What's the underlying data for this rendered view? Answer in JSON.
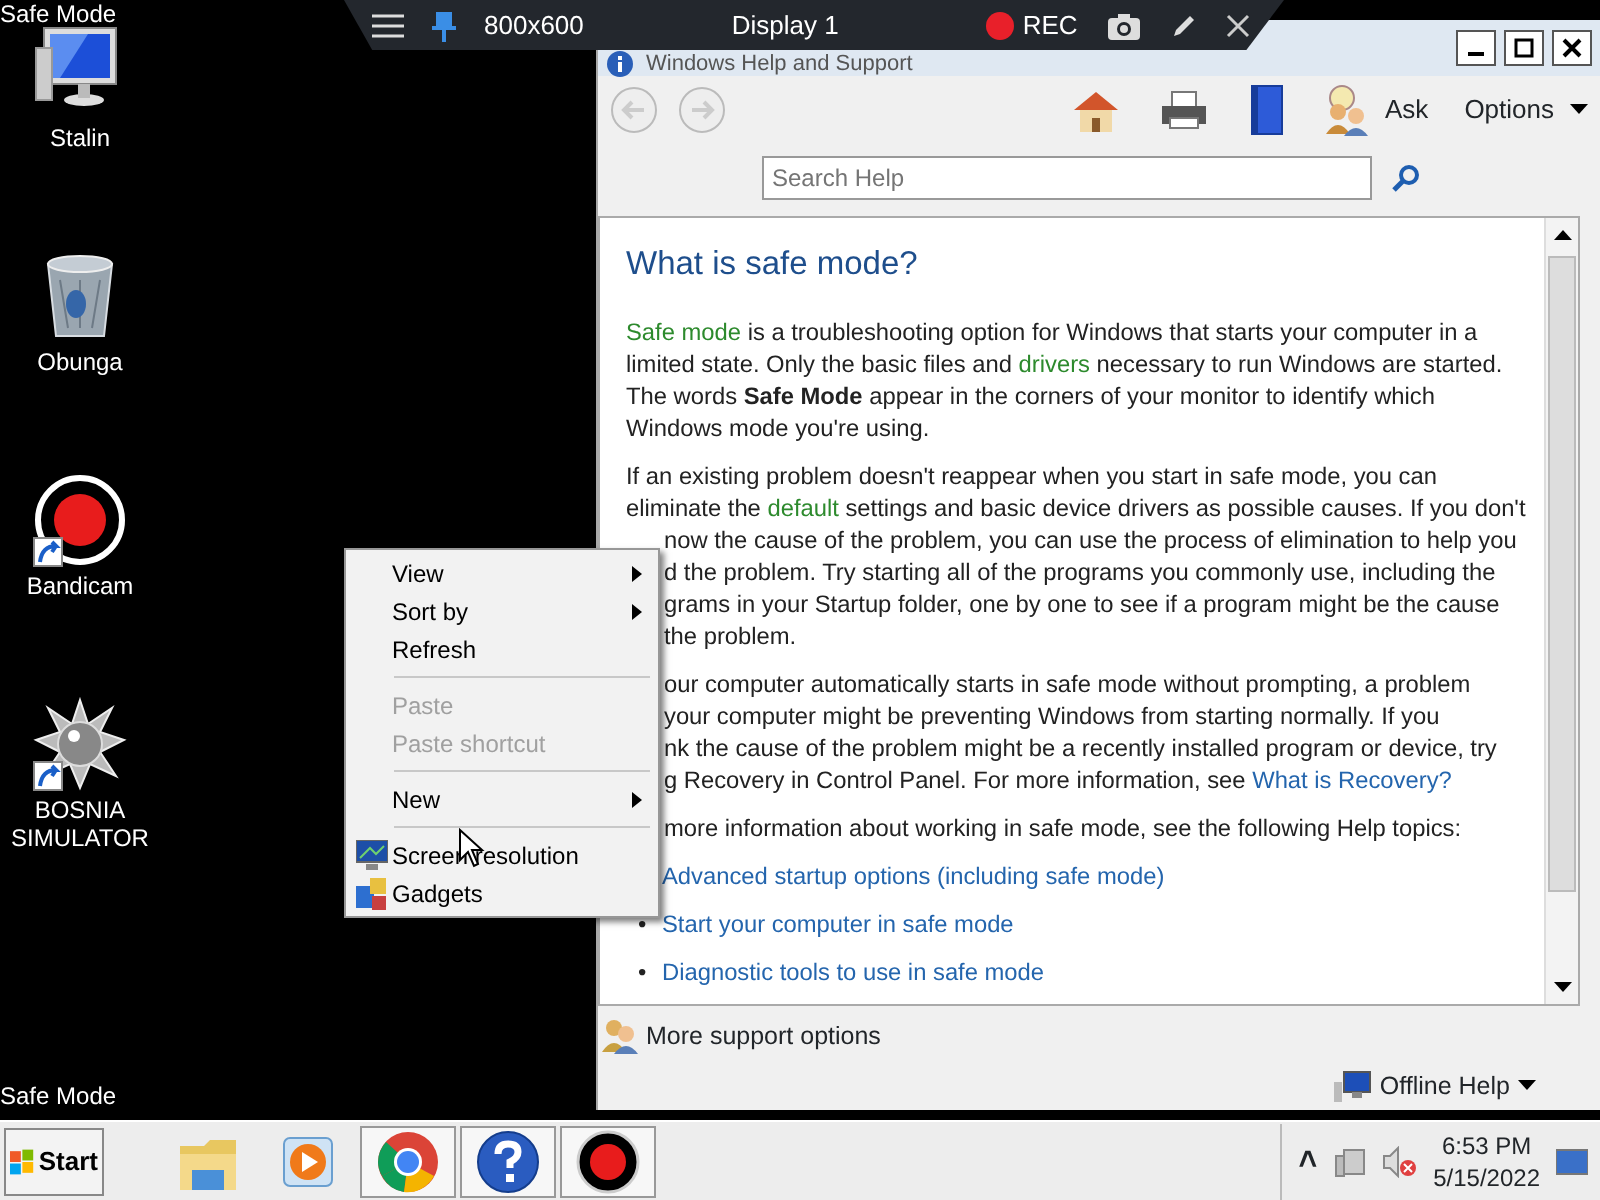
{
  "desktop": {
    "corner_labels": [
      "Safe Mode",
      "Safe Mode"
    ],
    "icons": [
      {
        "label": "Stalin",
        "kind": "computer",
        "shortcut": false
      },
      {
        "label": "Obunga",
        "kind": "recycle-bin",
        "shortcut": false
      },
      {
        "label": "Bandicam",
        "kind": "record",
        "shortcut": true
      },
      {
        "label": "BOSNIA SIMULATOR",
        "kind": "spiky-ball",
        "shortcut": true
      }
    ]
  },
  "recorder_toolbar": {
    "resolution": "800x600",
    "display": "Display 1",
    "rec": "REC"
  },
  "help_window": {
    "title": "Windows Help and Support",
    "ask": "Ask",
    "options": "Options",
    "search": {
      "placeholder": "Search Help"
    },
    "heading": "What is safe mode?",
    "paragraphs": [
      [
        {
          "kind": "full",
          "segments": [
            {
              "kind": "term",
              "text": "Safe mode"
            },
            {
              "kind": "text",
              "text": " is a troubleshooting option for Windows that starts your computer in a"
            }
          ]
        },
        {
          "kind": "full",
          "segments": [
            {
              "kind": "text",
              "text": "limited state. Only the basic files and "
            },
            {
              "kind": "term",
              "text": "drivers"
            },
            {
              "kind": "text",
              "text": " necessary to run Windows are started."
            }
          ]
        },
        {
          "kind": "full",
          "segments": [
            {
              "kind": "text",
              "text": "The words **Safe Mode** appear in the corners of your monitor to identify which"
            }
          ]
        },
        {
          "kind": "full",
          "segments": [
            {
              "kind": "text",
              "text": "Windows mode you're using."
            }
          ]
        }
      ],
      [
        {
          "kind": "full",
          "segments": [
            {
              "kind": "text",
              "text": "If an existing problem doesn't reappear when you start in safe mode, you can"
            }
          ]
        },
        {
          "kind": "full",
          "segments": [
            {
              "kind": "text",
              "text": "eliminate the "
            },
            {
              "kind": "term",
              "text": "default"
            },
            {
              "kind": "text",
              "text": " settings and basic device drivers as possible causes. If you don't"
            }
          ]
        },
        {
          "kind": "cut",
          "segments": [
            {
              "kind": "text",
              "text": "now the cause of the problem, you can use the process of elimination to help you"
            }
          ]
        },
        {
          "kind": "cut",
          "segments": [
            {
              "kind": "text",
              "text": "d the problem. Try starting all of the programs you commonly use, including the"
            }
          ]
        },
        {
          "kind": "cut",
          "segments": [
            {
              "kind": "text",
              "text": "grams in your Startup folder, one by one to see if a program might be the cause"
            }
          ]
        },
        {
          "kind": "cut",
          "segments": [
            {
              "kind": "text",
              "text": "the problem."
            }
          ]
        }
      ],
      [
        {
          "kind": "cut",
          "segments": [
            {
              "kind": "text",
              "text": "our computer automatically starts in safe mode without prompting, a problem"
            }
          ]
        },
        {
          "kind": "cut",
          "segments": [
            {
              "kind": "text",
              "text": "your computer might be preventing Windows from starting normally. If you"
            }
          ]
        },
        {
          "kind": "cut",
          "segments": [
            {
              "kind": "text",
              "text": "nk the cause of the problem might be a recently installed program or device, try"
            }
          ]
        },
        {
          "kind": "cut",
          "segments": [
            {
              "kind": "text",
              "text": "g Recovery in Control Panel. For more information, see "
            },
            {
              "kind": "link",
              "text": "What is Recovery?"
            }
          ]
        }
      ],
      [
        {
          "kind": "cut",
          "segments": [
            {
              "kind": "text",
              "text": "more information about working in safe mode, see the following Help topics:"
            }
          ]
        }
      ]
    ],
    "topics": [
      {
        "text": "Advanced startup options (including safe mode)"
      },
      {
        "bullet": "•",
        "text": "Start your computer in safe mode"
      },
      {
        "bullet": "•",
        "text": "Diagnostic tools to use in safe mode"
      }
    ],
    "more_support": "More support options",
    "offline_help": "Offline Help"
  },
  "context_menu": [
    {
      "kind": "item",
      "label": "View",
      "submenu": true,
      "disabled": false
    },
    {
      "kind": "item",
      "label": "Sort by",
      "submenu": true,
      "disabled": false
    },
    {
      "kind": "item",
      "label": "Refresh",
      "submenu": false,
      "disabled": false
    },
    {
      "kind": "separator"
    },
    {
      "kind": "item",
      "label": "Paste",
      "submenu": false,
      "disabled": true
    },
    {
      "kind": "item",
      "label": "Paste shortcut",
      "submenu": false,
      "disabled": true
    },
    {
      "kind": "separator"
    },
    {
      "kind": "item",
      "label": "New",
      "submenu": true,
      "disabled": false
    },
    {
      "kind": "separator"
    },
    {
      "kind": "display",
      "label": "Screen resolution",
      "submenu": false,
      "disabled": false
    },
    {
      "kind": "gadgets",
      "label": "Gadgets",
      "submenu": false,
      "disabled": false
    }
  ],
  "taskbar": {
    "start": "Start",
    "apps": [
      {
        "kind": "folder",
        "running": false
      },
      {
        "kind": "media",
        "running": false
      },
      {
        "kind": "chrome",
        "running": true
      },
      {
        "kind": "help",
        "running": true
      },
      {
        "kind": "record",
        "running": true
      }
    ],
    "tray_chevron": "˄",
    "time": "6:53 PM",
    "date": "5/15/2022"
  }
}
